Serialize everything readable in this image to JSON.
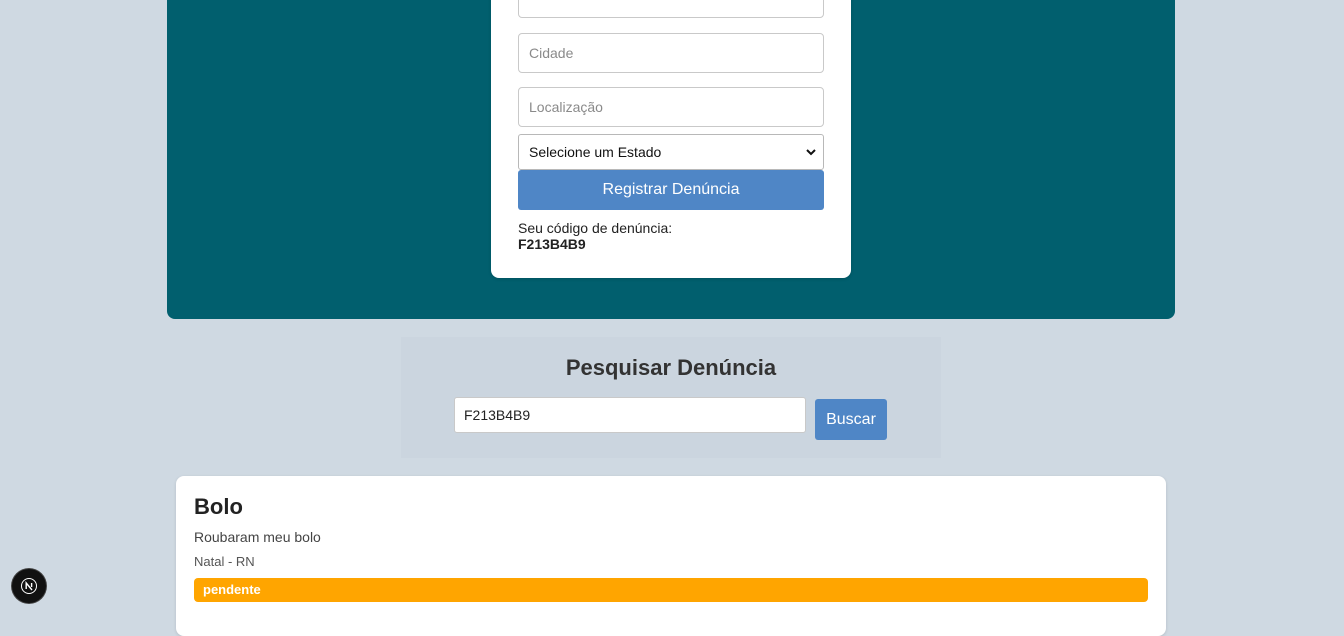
{
  "form": {
    "fields": [
      {
        "name": "previous",
        "value": "",
        "placeholder": ""
      },
      {
        "name": "cidade",
        "value": "",
        "placeholder": "Cidade"
      },
      {
        "name": "localizacao",
        "value": "",
        "placeholder": "Localização"
      }
    ],
    "estado_select": {
      "selected": "Selecione um Estado"
    },
    "submit_label": "Registrar Denúncia",
    "code_label": "Seu código de denúncia:",
    "code_value": "F213B4B9"
  },
  "search": {
    "title": "Pesquisar Denúncia",
    "input_value": "F213B4B9",
    "button_label": "Buscar"
  },
  "result": {
    "title": "Bolo",
    "description": "Roubaram meu bolo",
    "location": "Natal - RN",
    "status": "pendente"
  },
  "colors": {
    "hero": "#015f6e",
    "accent": "#4f86c6",
    "status_pending": "#ffa500",
    "background": "#cfd9e2"
  },
  "icons": {
    "select_chevron": "chevron-down-icon",
    "dev_badge": "nextjs-logo-icon"
  }
}
